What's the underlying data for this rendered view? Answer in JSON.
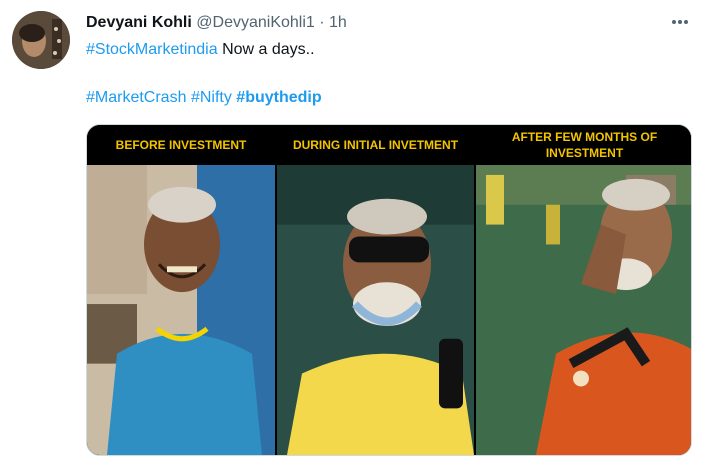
{
  "author": {
    "name": "Devyani Kohli",
    "handle": "@DevyaniKohli1",
    "separator": "·",
    "time": "1h"
  },
  "menu_icon": "more-horizontal-icon",
  "text": {
    "hashtag1": "#StockMarketindia",
    "line1_rest": " Now a days..",
    "hashtag2": "#MarketCrash",
    "hashtag3": "#Nifty",
    "hashtag4": "#buythedip"
  },
  "media": {
    "panels": [
      {
        "caption": "BEFORE INVESTMENT"
      },
      {
        "caption": "DURING INITIAL INVETMENT"
      },
      {
        "caption": "AFTER FEW MONTHS OF INVESTMENT"
      }
    ]
  },
  "colors": {
    "link": "#1d9bf0",
    "muted": "#536471",
    "caption_text": "#f3c400",
    "caption_bg": "#000000"
  }
}
